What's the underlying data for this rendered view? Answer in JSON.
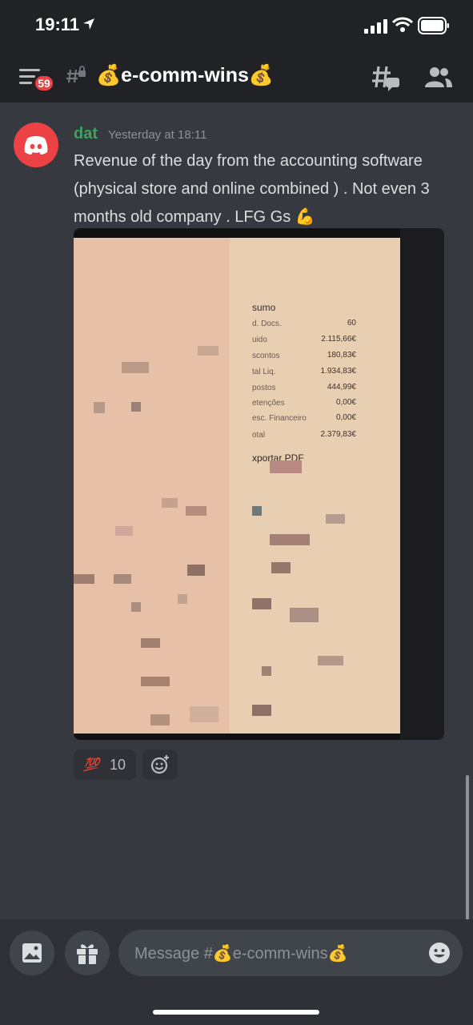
{
  "status": {
    "time": "19:11"
  },
  "header": {
    "unread_badge": "59",
    "channel_name": "💰e-comm-wins💰"
  },
  "message": {
    "author": "dat",
    "timestamp": "Yesterday at 18:11",
    "text": "Revenue of the day from the accounting software (physical store and online combined ) . Not even 3 months old company . LFG Gs 💪"
  },
  "attachment": {
    "title": "sumo",
    "rows": [
      {
        "label": "d. Docs.",
        "value": "60"
      },
      {
        "label": "uido",
        "value": "2.115,66€"
      },
      {
        "label": "scontos",
        "value": "180,83€"
      },
      {
        "label": "tal Liq.",
        "value": "1.934,83€"
      },
      {
        "label": "postos",
        "value": "444,99€"
      },
      {
        "label": "etenções",
        "value": "0,00€"
      },
      {
        "label": "esc. Financeiro",
        "value": "0,00€"
      },
      {
        "label": "otal",
        "value": "2.379,83€"
      }
    ],
    "export_label": "xportar PDF"
  },
  "reactions": [
    {
      "emoji": "💯",
      "count": "10"
    }
  ],
  "composer": {
    "placeholder": "Message #💰e-comm-wins💰"
  },
  "colors": {
    "background": "#36393f",
    "topbar": "#202225",
    "author": "#3ba55d",
    "badge": "#ed4245",
    "input_bg": "#40444b"
  }
}
